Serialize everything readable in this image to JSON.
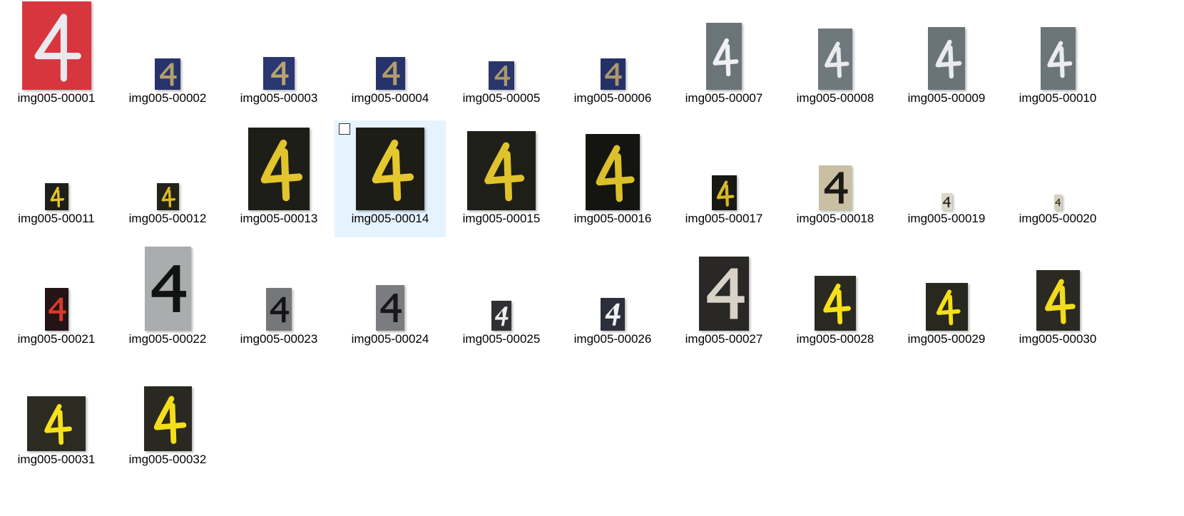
{
  "window": {
    "background": "#ffffff",
    "selection_color": "#e5f3ff"
  },
  "files": [
    {
      "name": "img005-00001",
      "bg": "#d8363e",
      "fg": "#e9e9ee",
      "style": "outline"
    },
    {
      "name": "img005-00002",
      "bg": "#27336a",
      "fg": "#b4a070",
      "style": "bold"
    },
    {
      "name": "img005-00003",
      "bg": "#2b3770",
      "fg": "#b9a573",
      "style": "bold"
    },
    {
      "name": "img005-00004",
      "bg": "#26336b",
      "fg": "#b19e6e",
      "style": "bold"
    },
    {
      "name": "img005-00005",
      "bg": "#2a356c",
      "fg": "#ad9a6b",
      "style": "bold"
    },
    {
      "name": "img005-00006",
      "bg": "#243066",
      "fg": "#a9976a",
      "style": "bold"
    },
    {
      "name": "img005-00007",
      "bg": "#6b7478",
      "fg": "#eef0f2",
      "style": "brush"
    },
    {
      "name": "img005-00008",
      "bg": "#6f787c",
      "fg": "#e8eaec",
      "style": "brush"
    },
    {
      "name": "img005-00009",
      "bg": "#6a7377",
      "fg": "#e9ebee",
      "style": "brush"
    },
    {
      "name": "img005-00010",
      "bg": "#6c7579",
      "fg": "#eaecef",
      "style": "brush"
    },
    {
      "name": "img005-00011",
      "bg": "#1f1f1a",
      "fg": "#e3c52a",
      "style": "brush"
    },
    {
      "name": "img005-00012",
      "bg": "#222218",
      "fg": "#d9bb26",
      "style": "brush"
    },
    {
      "name": "img005-00013",
      "bg": "#1e1e19",
      "fg": "#e2c52c",
      "style": "brush"
    },
    {
      "name": "img005-00014",
      "bg": "#1d1d18",
      "fg": "#e5c82e",
      "style": "brush",
      "selected": true
    },
    {
      "name": "img005-00015",
      "bg": "#1f1f1a",
      "fg": "#e0c32c",
      "style": "brush"
    },
    {
      "name": "img005-00016",
      "bg": "#141410",
      "fg": "#dcc02a",
      "style": "brush"
    },
    {
      "name": "img005-00017",
      "bg": "#181814",
      "fg": "#d7b826",
      "style": "brush"
    },
    {
      "name": "img005-00018",
      "bg": "#c9c0a4",
      "fg": "#1c1a16",
      "style": "bold"
    },
    {
      "name": "img005-00019",
      "bg": "#ddd9c9",
      "fg": "#2a2824",
      "style": "bold"
    },
    {
      "name": "img005-00020",
      "bg": "#d6d0bd",
      "fg": "#3a3630",
      "style": "bold"
    },
    {
      "name": "img005-00021",
      "bg": "#241416",
      "fg": "#d83a2a",
      "style": "bold"
    },
    {
      "name": "img005-00022",
      "bg": "#a9adad",
      "fg": "#121212",
      "style": "bold"
    },
    {
      "name": "img005-00023",
      "bg": "#75777a",
      "fg": "#141416",
      "style": "bold"
    },
    {
      "name": "img005-00024",
      "bg": "#7a7c7f",
      "fg": "#18181a",
      "style": "bold"
    },
    {
      "name": "img005-00025",
      "bg": "#303034",
      "fg": "#eeeeea",
      "style": "italic"
    },
    {
      "name": "img005-00026",
      "bg": "#2c2e3a",
      "fg": "#f0f0f0",
      "style": "italic"
    },
    {
      "name": "img005-00027",
      "bg": "#2a2826",
      "fg": "#d8d3c6",
      "style": "bold"
    },
    {
      "name": "img005-00028",
      "bg": "#2a2a22",
      "fg": "#f7e21a",
      "style": "brush"
    },
    {
      "name": "img005-00029",
      "bg": "#28281f",
      "fg": "#f5df18",
      "style": "brush"
    },
    {
      "name": "img005-00030",
      "bg": "#2a2922",
      "fg": "#f2dc1c",
      "style": "brush"
    },
    {
      "name": "img005-00031",
      "bg": "#2c2b22",
      "fg": "#f6e11b",
      "style": "brush"
    },
    {
      "name": "img005-00032",
      "bg": "#2a2921",
      "fg": "#f4de1a",
      "style": "brush"
    }
  ]
}
